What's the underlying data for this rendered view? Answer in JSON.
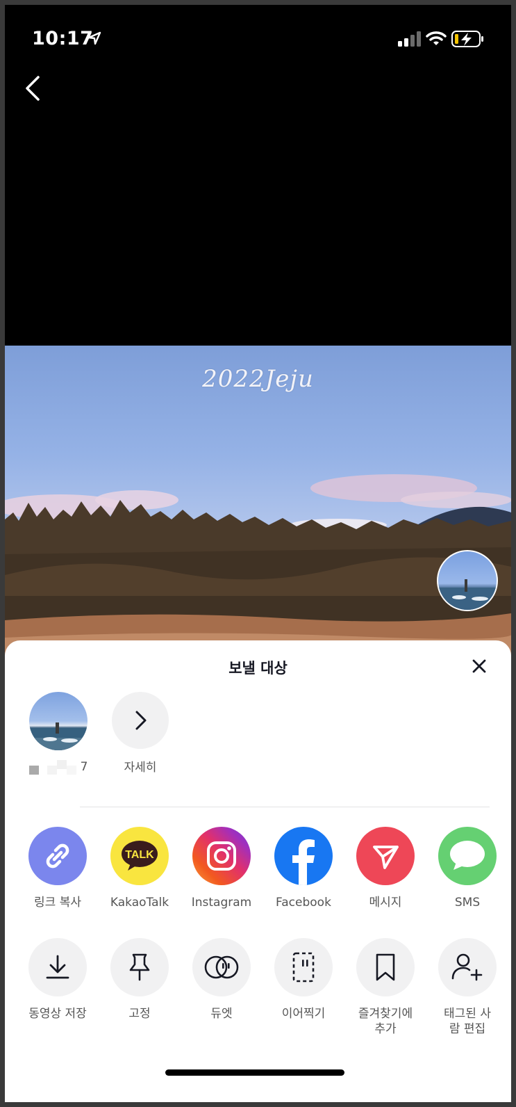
{
  "status_bar": {
    "time": "10:17",
    "icons": [
      "location-arrow-icon",
      "signal-icon",
      "wifi-icon",
      "battery-charging-icon"
    ]
  },
  "nav": {
    "back_icon": "chevron-left-icon"
  },
  "video": {
    "caption": "2022Jeju"
  },
  "share_sheet": {
    "title": "보낼 대상",
    "close_icon": "close-icon",
    "contacts": [
      {
        "name": "7",
        "name_redacted": true
      },
      {
        "name": "자세히",
        "icon": "chevron-right-icon"
      }
    ],
    "apps": [
      {
        "label": "링크 복사",
        "icon": "link-icon",
        "color": "#7b86ed"
      },
      {
        "label": "KakaoTalk",
        "icon": "kakaotalk-icon",
        "color": "#f9e53f"
      },
      {
        "label": "Instagram",
        "icon": "instagram-icon",
        "color": "#e1306c"
      },
      {
        "label": "Facebook",
        "icon": "facebook-icon",
        "color": "#1877f2"
      },
      {
        "label": "메시지",
        "icon": "send-icon",
        "color": "#ee4757"
      },
      {
        "label": "SMS",
        "icon": "sms-icon",
        "color": "#65d072"
      }
    ],
    "actions": [
      {
        "label": "동영상 저장",
        "icon": "download-icon"
      },
      {
        "label": "고정",
        "icon": "pin-icon"
      },
      {
        "label": "듀엣",
        "icon": "duet-icon"
      },
      {
        "label": "이어찍기",
        "icon": "stitch-icon"
      },
      {
        "label": "즐겨찾기에 추가",
        "icon": "bookmark-icon"
      },
      {
        "label": "태그된 사람 편집",
        "icon": "add-person-icon"
      }
    ]
  }
}
